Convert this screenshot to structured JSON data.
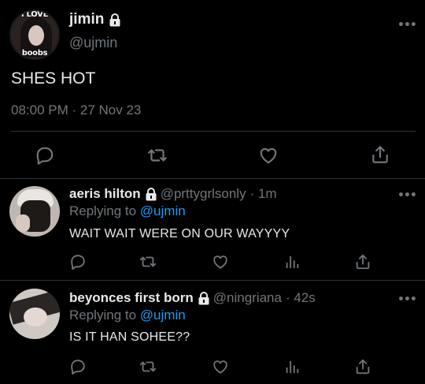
{
  "main_tweet": {
    "avatar_text_top": "I LOVE",
    "avatar_text_bottom": "boobs",
    "name": "jimin",
    "handle": "@ujmin",
    "text": "SHES HOT",
    "timestamp": "08:00 PM · 27 Nov 23",
    "more": "•••"
  },
  "replies": [
    {
      "name": "aeris hilton",
      "handle": "@prttygrlsonly",
      "time": "· 1m",
      "replying_prefix": "Replying to",
      "replying_to": "@ujmin",
      "text": "WAIT WAIT WERE ON OUR WAYYYY",
      "more": "•••"
    },
    {
      "name": "beyonces first born",
      "handle": "@ningriana",
      "time": "· 42s",
      "replying_prefix": "Replying to",
      "replying_to": "@ujmin",
      "text": "IS IT HAN SOHEE??",
      "more": "•••"
    }
  ],
  "icons": {
    "reply": "reply-icon",
    "retweet": "retweet-icon",
    "like": "like-icon",
    "views": "views-icon",
    "share": "share-icon",
    "lock": "lock-icon",
    "more": "more-icon"
  },
  "colors": {
    "background": "#000000",
    "text": "#e7e9ea",
    "muted": "#71767b",
    "link": "#1d9bf0",
    "divider": "#2f3336"
  }
}
